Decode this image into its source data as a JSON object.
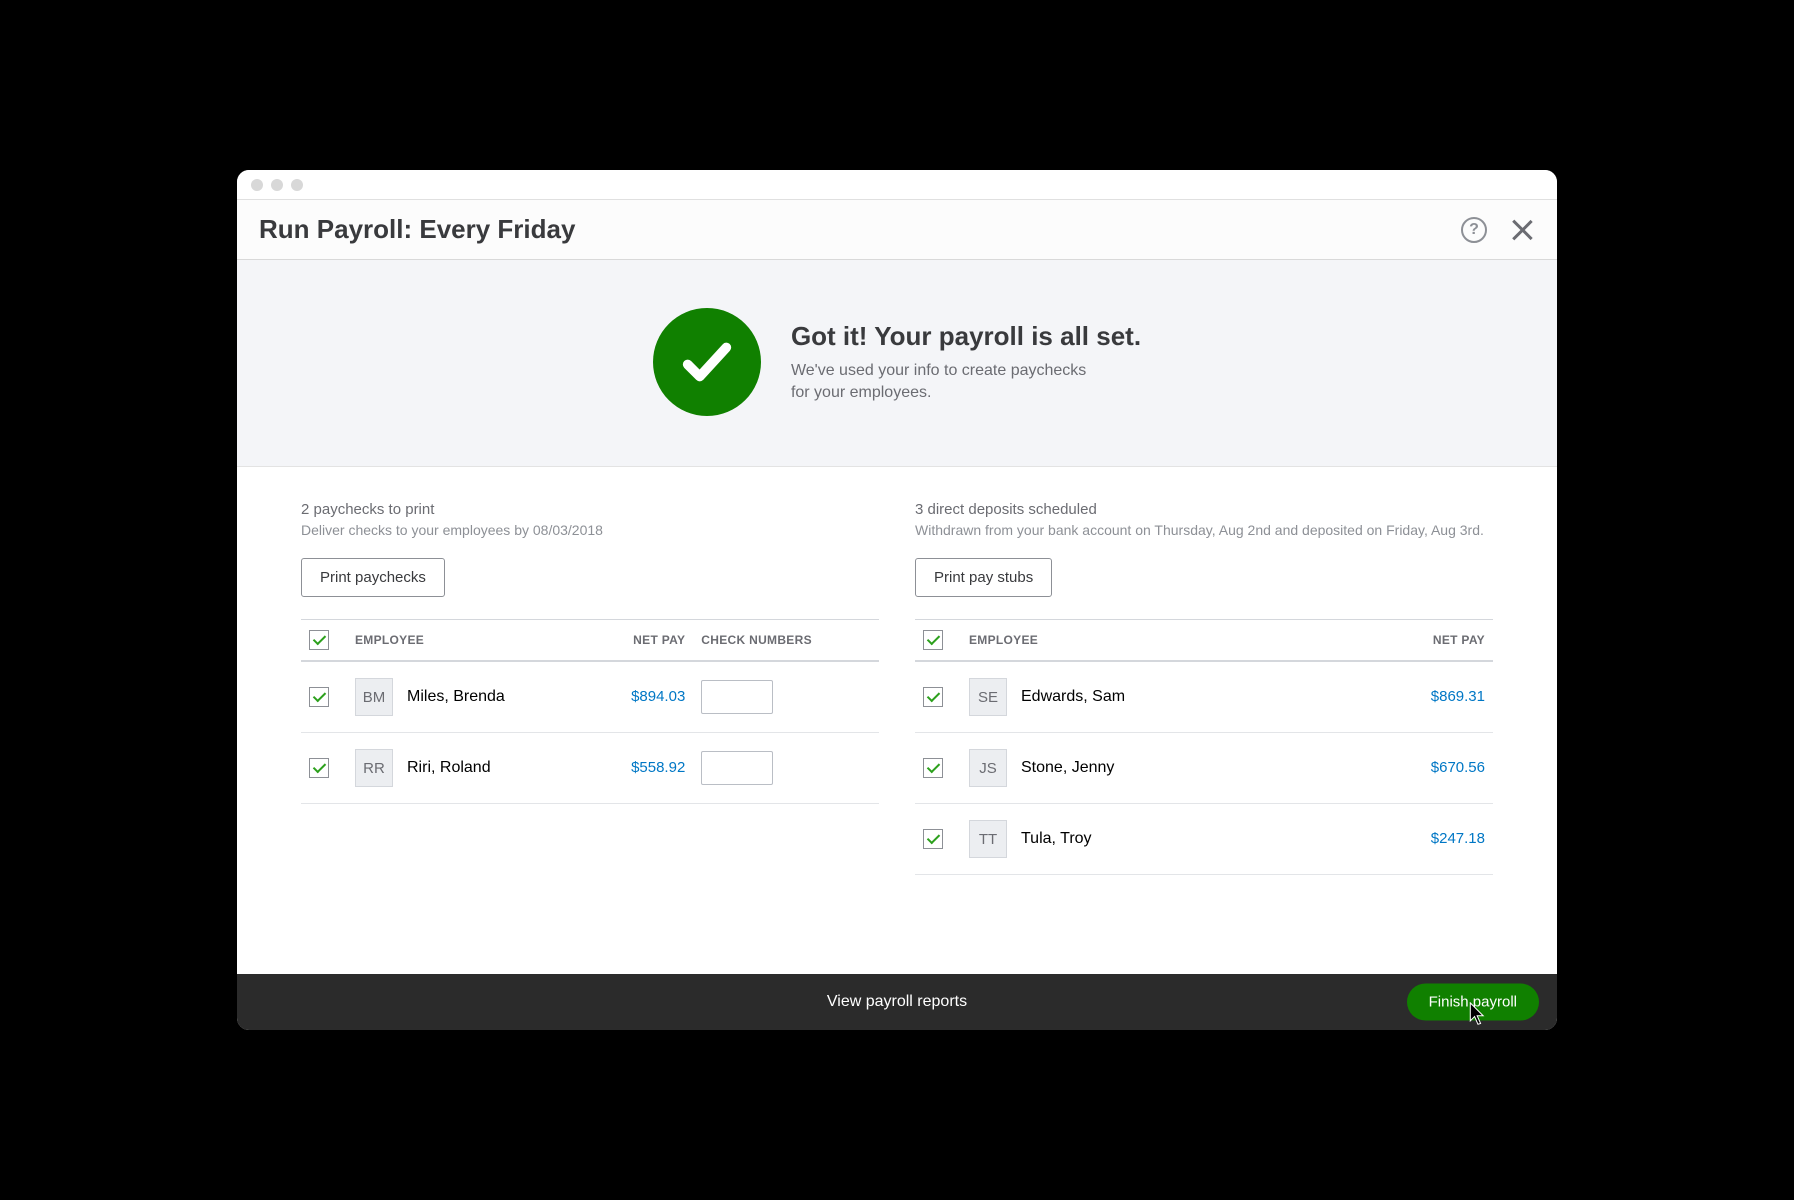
{
  "header": {
    "title": "Run Payroll: Every Friday"
  },
  "banner": {
    "headline": "Got it! Your payroll is all set.",
    "subtext": "We've used your info to create paychecks for your employees."
  },
  "paychecks": {
    "count_line": "2 paychecks to print",
    "deliver_line": "Deliver checks to your employees by 08/03/2018",
    "print_button": "Print paychecks",
    "columns": {
      "employee": "EMPLOYEE",
      "net_pay": "NET PAY",
      "check_numbers": "CHECK NUMBERS"
    },
    "rows": [
      {
        "initials": "BM",
        "name": "Miles, Brenda",
        "net_pay": "$894.03",
        "check_number": ""
      },
      {
        "initials": "RR",
        "name": "Riri, Roland",
        "net_pay": "$558.92",
        "check_number": ""
      }
    ]
  },
  "deposits": {
    "count_line": "3 direct deposits scheduled",
    "deliver_line": "Withdrawn from your bank account on Thursday, Aug 2nd and deposited on Friday, Aug 3rd.",
    "print_button": "Print pay stubs",
    "columns": {
      "employee": "EMPLOYEE",
      "net_pay": "NET PAY"
    },
    "rows": [
      {
        "initials": "SE",
        "name": "Edwards, Sam",
        "net_pay": "$869.31"
      },
      {
        "initials": "JS",
        "name": "Stone, Jenny",
        "net_pay": "$670.56"
      },
      {
        "initials": "TT",
        "name": "Tula, Troy",
        "net_pay": "$247.18"
      }
    ]
  },
  "footer": {
    "view_reports": "View payroll reports",
    "finish": "Finish payroll"
  }
}
